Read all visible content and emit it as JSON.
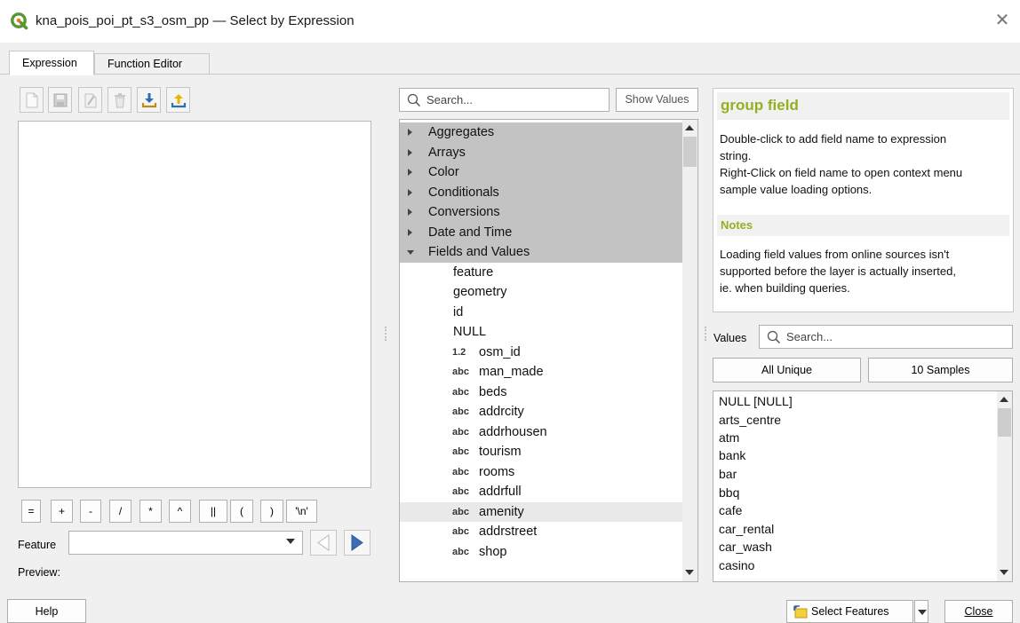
{
  "window": {
    "title": "kna_pois_poi_pt_s3_osm_pp — Select by Expression",
    "close_glyph": "✕"
  },
  "tabs": [
    {
      "label": "Expression",
      "active": true
    },
    {
      "label": "Function Editor",
      "active": false
    }
  ],
  "operators": [
    "=",
    "+",
    "-",
    "/",
    "*",
    "^",
    "||",
    "(",
    ")",
    "'\\n'"
  ],
  "feature": {
    "label": "Feature",
    "value": ""
  },
  "preview": {
    "label": "Preview:"
  },
  "search": {
    "placeholder": "Search...",
    "show_values_label": "Show Values"
  },
  "tree": {
    "groups": [
      {
        "label": "Aggregates",
        "expanded": false
      },
      {
        "label": "Arrays",
        "expanded": false
      },
      {
        "label": "Color",
        "expanded": false
      },
      {
        "label": "Conditionals",
        "expanded": false
      },
      {
        "label": "Conversions",
        "expanded": false
      },
      {
        "label": "Date and Time",
        "expanded": false
      },
      {
        "label": "Fields and Values",
        "expanded": true
      }
    ],
    "children": [
      {
        "label": "feature",
        "type": ""
      },
      {
        "label": "geometry",
        "type": ""
      },
      {
        "label": "id",
        "type": ""
      },
      {
        "label": "NULL",
        "type": ""
      },
      {
        "label": "osm_id",
        "type": "1.2"
      },
      {
        "label": "man_made",
        "type": "abc"
      },
      {
        "label": "beds",
        "type": "abc"
      },
      {
        "label": "addrcity",
        "type": "abc"
      },
      {
        "label": "addrhousen",
        "type": "abc"
      },
      {
        "label": "tourism",
        "type": "abc"
      },
      {
        "label": "rooms",
        "type": "abc"
      },
      {
        "label": "addrfull",
        "type": "abc"
      },
      {
        "label": "amenity",
        "type": "abc",
        "highlighted": true
      },
      {
        "label": "addrstreet",
        "type": "abc"
      },
      {
        "label": "shop",
        "type": "abc"
      }
    ]
  },
  "help": {
    "title": "group field",
    "line1": "Double-click to add field name to expression",
    "line2": "string.",
    "line3": "Right-Click on field name to open context menu",
    "line4": "sample value loading options.",
    "notes_title": "Notes",
    "notes1": "Loading field values from online sources isn't",
    "notes2": "supported before the layer is actually inserted,",
    "notes3": "ie. when building queries.",
    "title_color": "#93b023"
  },
  "values": {
    "label": "Values",
    "search_placeholder": "Search...",
    "all_unique_label": "All Unique",
    "samples_label": "10 Samples",
    "items": [
      "NULL [NULL]",
      "arts_centre",
      "atm",
      "bank",
      "bar",
      "bbq",
      "cafe",
      "car_rental",
      "car_wash",
      "casino"
    ]
  },
  "footer": {
    "help_label": "Help",
    "select_features_label": "Select Features",
    "close_label": "Close"
  }
}
